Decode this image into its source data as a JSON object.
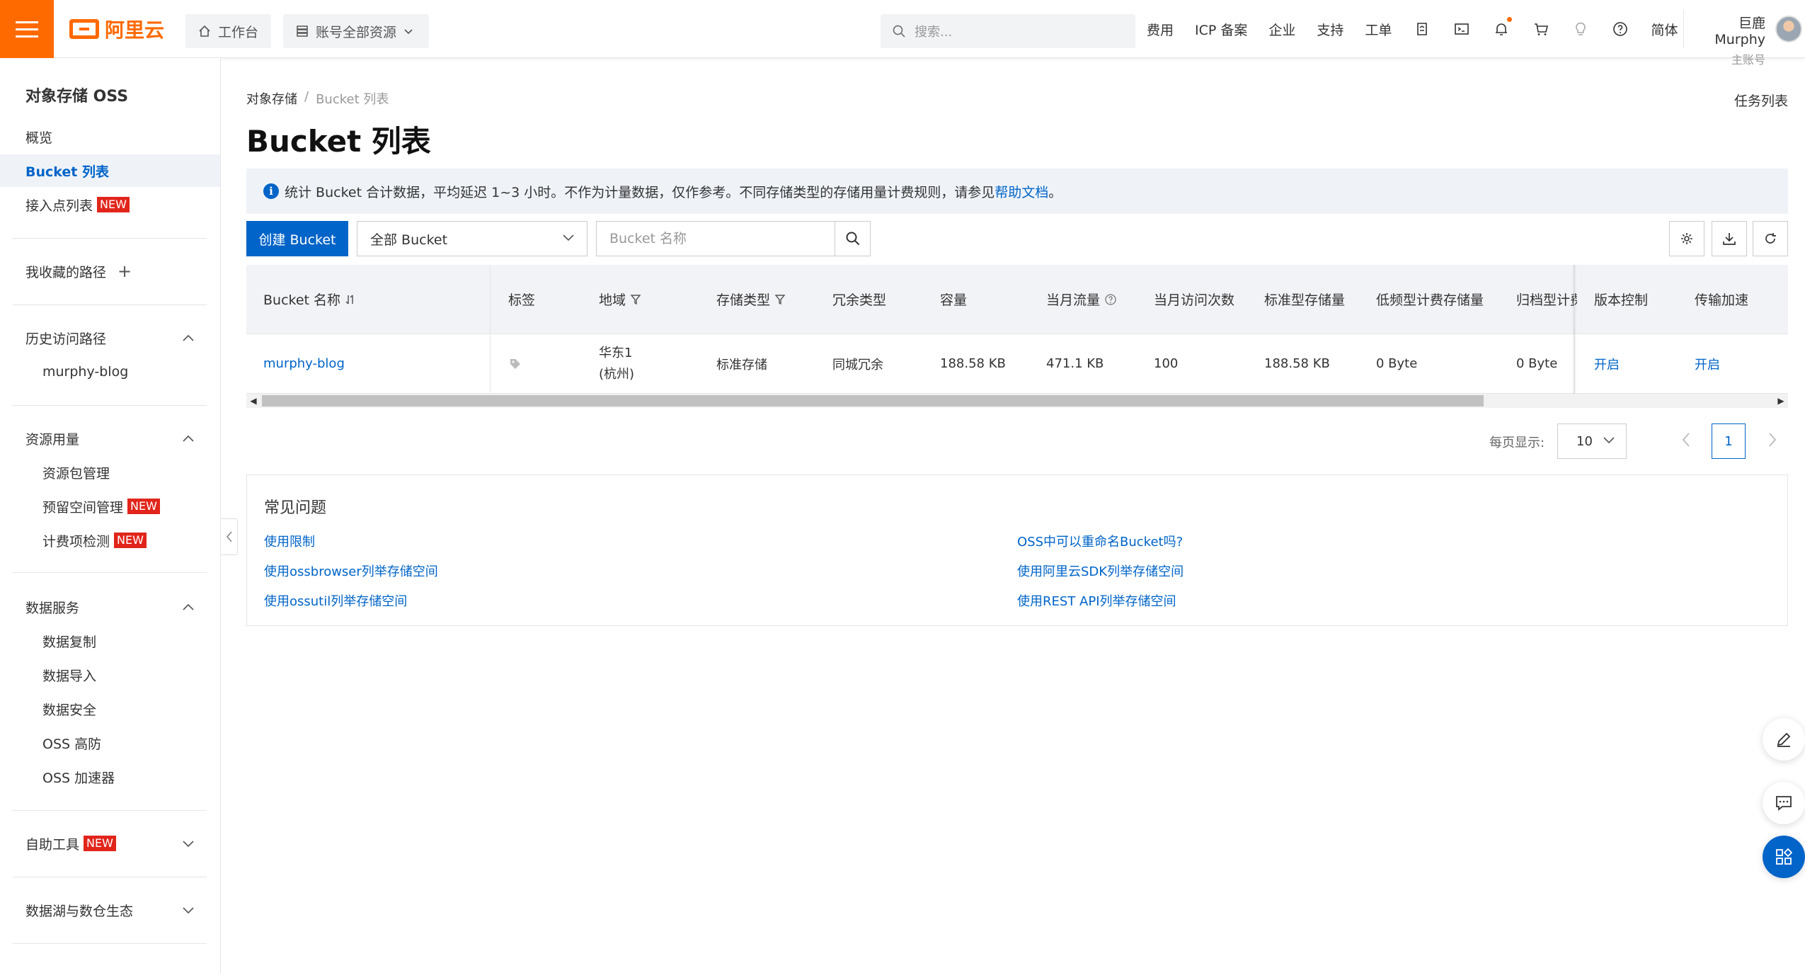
{
  "header": {
    "logo_text": "阿里云",
    "workbench": "工作台",
    "resources": "账号全部资源",
    "search_placeholder": "搜索...",
    "links": [
      "费用",
      "ICP 备案",
      "企业",
      "支持",
      "工单"
    ],
    "lang": "简体",
    "user_name": "巨鹿Murphy",
    "user_role": "主账号"
  },
  "sidebar": {
    "title": "对象存储 OSS",
    "overview": "概览",
    "bucket_list": "Bucket 列表",
    "access_point": "接入点列表",
    "favorite_paths": "我收藏的路径",
    "history": "历史访问路径",
    "history_item": "murphy-blog",
    "usage": "资源用量",
    "usage_items": [
      "资源包管理",
      "预留空间管理",
      "计费项检测"
    ],
    "data_service": "数据服务",
    "data_items": [
      "数据复制",
      "数据导入",
      "数据安全",
      "OSS 高防",
      "OSS 加速器"
    ],
    "self_tools": "自助工具",
    "data_lake": "数据湖与数仓生态",
    "new_badge": "NEW"
  },
  "main": {
    "breadcrumb_root": "对象存储",
    "breadcrumb_sep": "/",
    "breadcrumb_current": "Bucket 列表",
    "task_list": "任务列表",
    "title": "Bucket 列表",
    "info_text": "统计 Bucket 合计数据，平均延迟 1~3 小时。不作为计量数据，仅作参考。不同存储类型的存储用量计费规则，请参见",
    "info_link": "帮助文档",
    "info_end": "。",
    "create_button": "创建 Bucket",
    "filter_select": "全部 Bucket",
    "search_placeholder": "Bucket 名称"
  },
  "table": {
    "headers": [
      "Bucket 名称",
      "标签",
      "地域",
      "存储类型",
      "冗余类型",
      "容量",
      "当月流量",
      "当月访问次数",
      "标准型存储量",
      "低频型计费存储量",
      "归档型计费",
      "版本控制",
      "传输加速"
    ],
    "row": {
      "name": "murphy-blog",
      "region_line1": "华东1",
      "region_line2": "(杭州)",
      "storage_type": "标准存储",
      "redundancy": "同城冗余",
      "capacity": "188.58 KB",
      "traffic": "471.1 KB",
      "visits": "100",
      "standard_storage": "188.58 KB",
      "ia_storage": "0 Byte",
      "archive_storage": "0 Byte",
      "versioning": "开启",
      "acceleration": "开启"
    }
  },
  "pagination": {
    "page_size_label": "每页显示:",
    "page_size": "10",
    "current_page": "1"
  },
  "faq": {
    "title": "常见问题",
    "links": [
      "使用限制",
      "使用ossbrowser列举存储空间",
      "使用ossutil列举存储空间",
      "OSS中可以重命名Bucket吗?",
      "使用阿里云SDK列举存储空间",
      "使用REST API列举存储空间"
    ]
  },
  "colors": {
    "brand": "#ff6a00",
    "primary": "#0064c8",
    "new_badge": "#e1251b"
  }
}
